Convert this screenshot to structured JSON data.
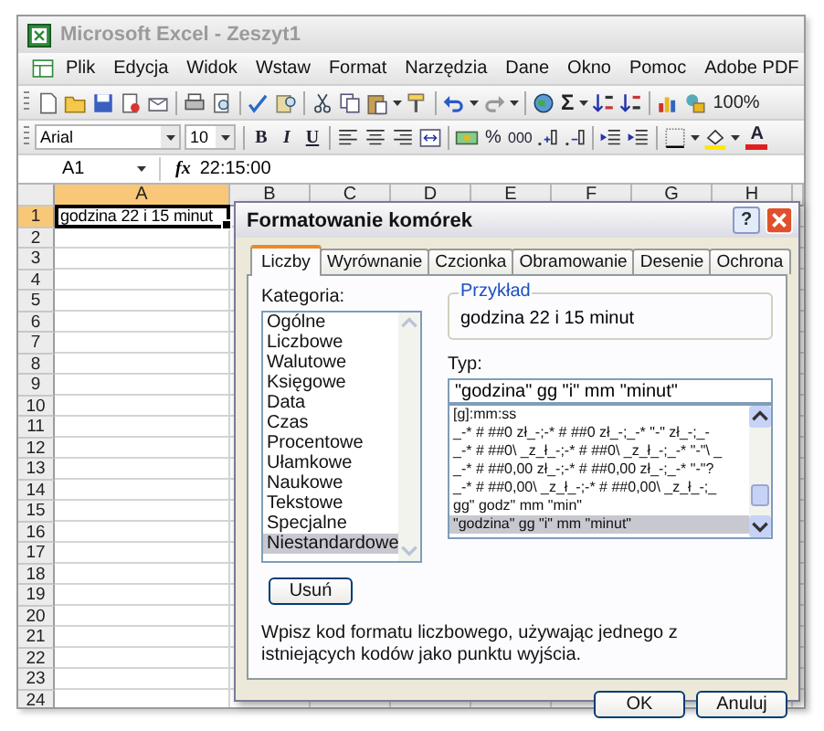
{
  "window": {
    "title": "Microsoft Excel - Zeszyt1"
  },
  "menu": [
    {
      "label": "Plik"
    },
    {
      "label": "Edycja"
    },
    {
      "label": "Widok"
    },
    {
      "label": "Wstaw"
    },
    {
      "label": "Format"
    },
    {
      "label": "Narzędzia"
    },
    {
      "label": "Dane"
    },
    {
      "label": "Okno"
    },
    {
      "label": "Pomoc"
    },
    {
      "label": "Adobe PDF"
    }
  ],
  "standard_toolbar": {
    "autosum": "Σ",
    "zoom": "100%"
  },
  "formatting_toolbar": {
    "font": "Arial",
    "size": "10",
    "bold": "B",
    "italic": "I",
    "underline": "U",
    "percent": "%",
    "thousands": "000",
    "font_color": "A"
  },
  "formula_bar": {
    "name_box": "A1",
    "fx": "fx",
    "value": "22:15:00"
  },
  "columns": [
    {
      "label": "A",
      "selected": true
    },
    {
      "label": "B",
      "selected": false
    },
    {
      "label": "C",
      "selected": false
    },
    {
      "label": "D",
      "selected": false
    },
    {
      "label": "E",
      "selected": false
    },
    {
      "label": "F",
      "selected": false
    },
    {
      "label": "G",
      "selected": false
    },
    {
      "label": "H",
      "selected": false
    }
  ],
  "rows": [
    {
      "label": "1",
      "selected": true,
      "cells": [
        "godzina 22 i 15 minut"
      ]
    },
    {
      "label": "2",
      "selected": false
    },
    {
      "label": "3",
      "selected": false
    },
    {
      "label": "4",
      "selected": false
    },
    {
      "label": "5",
      "selected": false
    },
    {
      "label": "6",
      "selected": false
    },
    {
      "label": "7",
      "selected": false
    },
    {
      "label": "8",
      "selected": false
    },
    {
      "label": "9",
      "selected": false
    },
    {
      "label": "10",
      "selected": false
    },
    {
      "label": "11",
      "selected": false
    },
    {
      "label": "12",
      "selected": false
    },
    {
      "label": "13",
      "selected": false
    },
    {
      "label": "14",
      "selected": false
    },
    {
      "label": "15",
      "selected": false
    },
    {
      "label": "16",
      "selected": false
    },
    {
      "label": "17",
      "selected": false
    },
    {
      "label": "18",
      "selected": false
    },
    {
      "label": "19",
      "selected": false
    },
    {
      "label": "20",
      "selected": false
    },
    {
      "label": "21",
      "selected": false
    },
    {
      "label": "22",
      "selected": false
    },
    {
      "label": "23",
      "selected": false
    },
    {
      "label": "24",
      "selected": false
    }
  ],
  "dialog": {
    "title": "Formatowanie komórek",
    "help": "?",
    "tabs": [
      {
        "label": "Liczby",
        "selected": true
      },
      {
        "label": "Wyrównanie",
        "selected": false
      },
      {
        "label": "Czcionka",
        "selected": false
      },
      {
        "label": "Obramowanie",
        "selected": false
      },
      {
        "label": "Desenie",
        "selected": false
      },
      {
        "label": "Ochrona",
        "selected": false
      }
    ],
    "category_label": "Kategoria:",
    "categories": [
      {
        "label": "Ogólne",
        "selected": false
      },
      {
        "label": "Liczbowe",
        "selected": false
      },
      {
        "label": "Walutowe",
        "selected": false
      },
      {
        "label": "Księgowe",
        "selected": false
      },
      {
        "label": "Data",
        "selected": false
      },
      {
        "label": "Czas",
        "selected": false
      },
      {
        "label": "Procentowe",
        "selected": false
      },
      {
        "label": "Ułamkowe",
        "selected": false
      },
      {
        "label": "Naukowe",
        "selected": false
      },
      {
        "label": "Tekstowe",
        "selected": false
      },
      {
        "label": "Specjalne",
        "selected": false
      },
      {
        "label": "Niestandardowe",
        "selected": true
      }
    ],
    "sample_label": "Przykład",
    "sample": "godzina 22 i 15 minut",
    "type_label": "Typ:",
    "type_value": "\"godzina\" gg \"i\" mm \"minut\"",
    "formats": [
      {
        "label": "[g]:mm:ss",
        "selected": false
      },
      {
        "label": "_-* # ##0 zł_-;-* # ##0 zł_-;_-* \"-\" zł_-;_-",
        "selected": false
      },
      {
        "label": "_-* # ##0\\ _z_ł_-;-* # ##0\\ _z_ł_-;_-* \"-\"\\ _",
        "selected": false
      },
      {
        "label": "_-* # ##0,00 zł_-;-* # ##0,00 zł_-;_-* \"-\"?",
        "selected": false
      },
      {
        "label": "_-* # ##0,00\\ _z_ł_-;-* # ##0,00\\ _z_ł_-;_",
        "selected": false
      },
      {
        "label": "gg\" godz\" mm \"min\"",
        "selected": false
      },
      {
        "label": "\"godzina\" gg \"i\" mm \"minut\"",
        "selected": true
      }
    ],
    "delete_button": "Usuń",
    "description": "Wpisz kod formatu liczbowego, używając jednego z istniejących kodów jako punktu wyjścia.",
    "buttons": [
      "OK",
      "Anuluj"
    ]
  }
}
